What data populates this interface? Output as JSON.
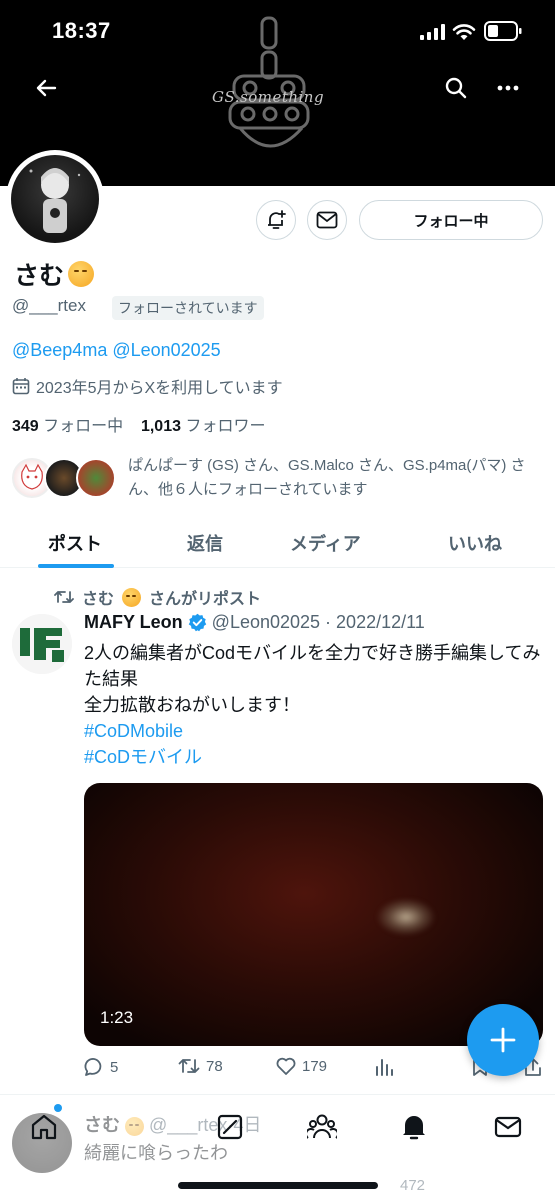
{
  "status_bar": {
    "time": "18:37"
  },
  "banner": {
    "text": "GS.something"
  },
  "profile": {
    "display_name": "さむ",
    "handle": "@___rtex",
    "follows_you_label": "フォローされています",
    "follow_button_label": "フォロー中",
    "bio": "@Beep4ma @Leon02025",
    "joined": "2023年5月からXを利用しています",
    "following_count": "349",
    "following_label": "フォロー中",
    "followers_count": "1,013",
    "followers_label": "フォロワー",
    "mutuals_text": "ぱんぱーす (GS) さん、GS.Malco さん、GS.p4ma(パマ) さん、他６人にフォローされています"
  },
  "tabs": [
    {
      "label": "ポスト",
      "active": true
    },
    {
      "label": "返信",
      "active": false
    },
    {
      "label": "メディア",
      "active": false
    },
    {
      "label": "いいね",
      "active": false
    }
  ],
  "post": {
    "repost_by": "さむ",
    "repost_suffix": "さんがリポスト",
    "author": "MAFY Leon",
    "handle": "@Leon02025",
    "date": "2022/12/11",
    "line1": "2人の編集者がCodモバイルを全力で好き勝手編集してみた結果",
    "line2": "全力拡散おねがいします！",
    "hashtag1": "#CoDMobile",
    "hashtag2": "#CoDモバイル",
    "video_duration": "1:23",
    "replies": "5",
    "reposts": "78",
    "likes": "179"
  },
  "next_post": {
    "author": "さむ",
    "handle": "@___rtex",
    "time": "4日",
    "text": "綺麗に喰らったわ",
    "views": "472"
  },
  "colors": {
    "accent": "#1d9bf0",
    "text": "#0f1419",
    "muted": "#536471"
  }
}
